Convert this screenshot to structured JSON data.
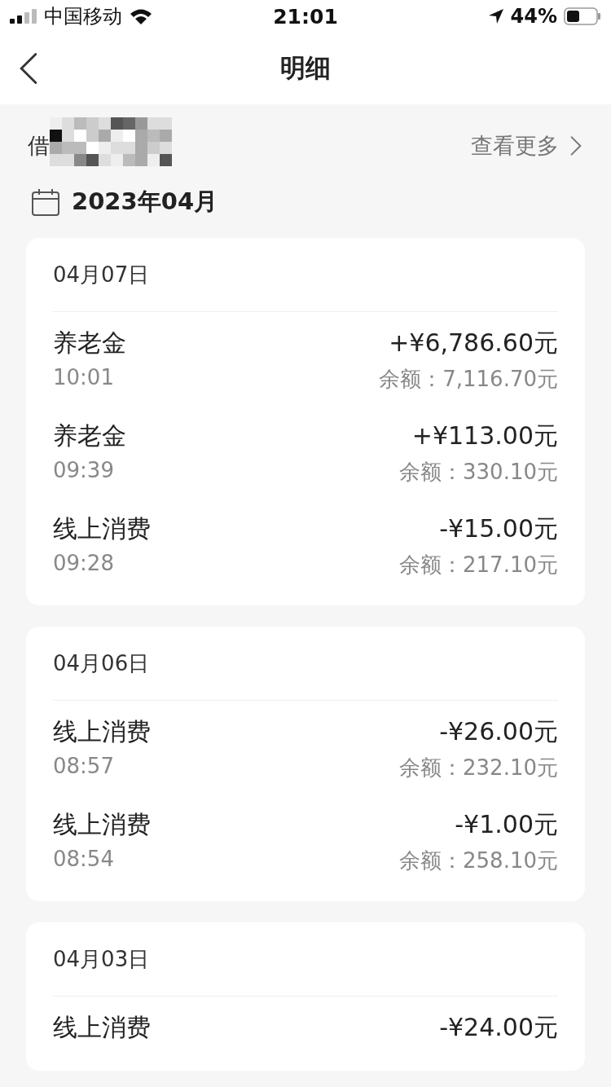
{
  "status_bar": {
    "carrier": "中国移动",
    "time": "21:01",
    "battery": "44%"
  },
  "nav": {
    "title": "明细"
  },
  "account": {
    "label": "借",
    "more": "查看更多"
  },
  "month": "2023年04月",
  "days": [
    {
      "date": "04月07日",
      "items": [
        {
          "name": "养老金",
          "time": "10:01",
          "amount": "+¥6,786.60元",
          "balance": "余额：7,116.70元"
        },
        {
          "name": "养老金",
          "time": "09:39",
          "amount": "+¥113.00元",
          "balance": "余额：330.10元"
        },
        {
          "name": "线上消费",
          "time": "09:28",
          "amount": "-¥15.00元",
          "balance": "余额：217.10元"
        }
      ]
    },
    {
      "date": "04月06日",
      "items": [
        {
          "name": "线上消费",
          "time": "08:57",
          "amount": "-¥26.00元",
          "balance": "余额：232.10元"
        },
        {
          "name": "线上消费",
          "time": "08:54",
          "amount": "-¥1.00元",
          "balance": "余额：258.10元"
        }
      ]
    },
    {
      "date": "04月03日",
      "items": [
        {
          "name": "线上消费",
          "amount": "-¥24.00元"
        }
      ]
    }
  ]
}
